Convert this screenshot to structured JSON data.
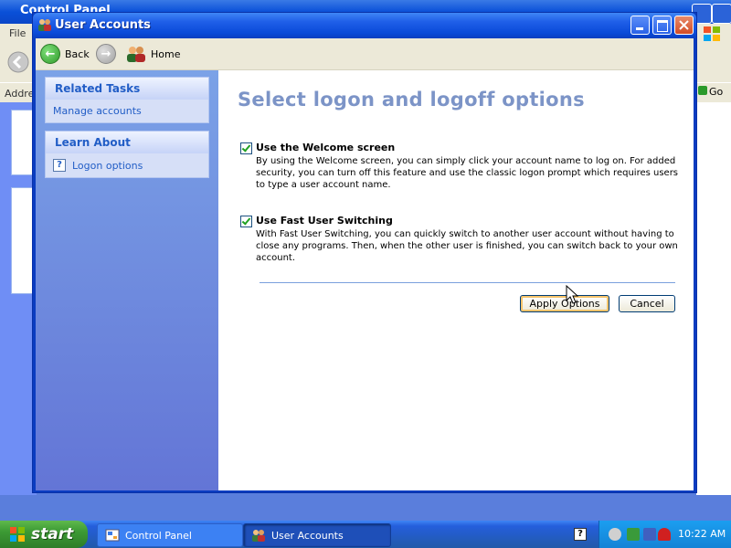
{
  "background_window": {
    "title": "Control Panel",
    "menu_file": "File",
    "address_label": "Addre",
    "go_label": "Go"
  },
  "window": {
    "title": "User Accounts"
  },
  "toolbar": {
    "back": "Back",
    "home": "Home"
  },
  "sidebar": {
    "related_tasks": {
      "header": "Related Tasks",
      "items": [
        {
          "label": "Manage accounts"
        }
      ]
    },
    "learn_about": {
      "header": "Learn About",
      "items": [
        {
          "label": "Logon options"
        }
      ]
    }
  },
  "content": {
    "title": "Select logon and logoff options",
    "options": [
      {
        "label": "Use the Welcome screen",
        "checked": true,
        "description": "By using the Welcome screen, you can simply click your account name to log on. For added security, you can turn off this feature and use the classic logon prompt which requires users to type a user account name."
      },
      {
        "label": "Use Fast User Switching",
        "checked": true,
        "description": "With Fast User Switching, you can quickly switch to another user account without having to close any programs. Then, when the other user is finished, you can switch back to your own account."
      }
    ],
    "apply_button": "Apply Options",
    "cancel_button": "Cancel"
  },
  "taskbar": {
    "start_label": "start",
    "tasks": [
      {
        "label": "Control Panel",
        "active": false
      },
      {
        "label": "User Accounts",
        "active": true
      }
    ],
    "clock": "10:22 AM"
  },
  "colors": {
    "title_blue": "#0a4ad8",
    "content_title": "#7c94c7",
    "link_blue": "#215dc6",
    "taskbar_blue": "#245edc",
    "start_green": "#3c9a34"
  }
}
